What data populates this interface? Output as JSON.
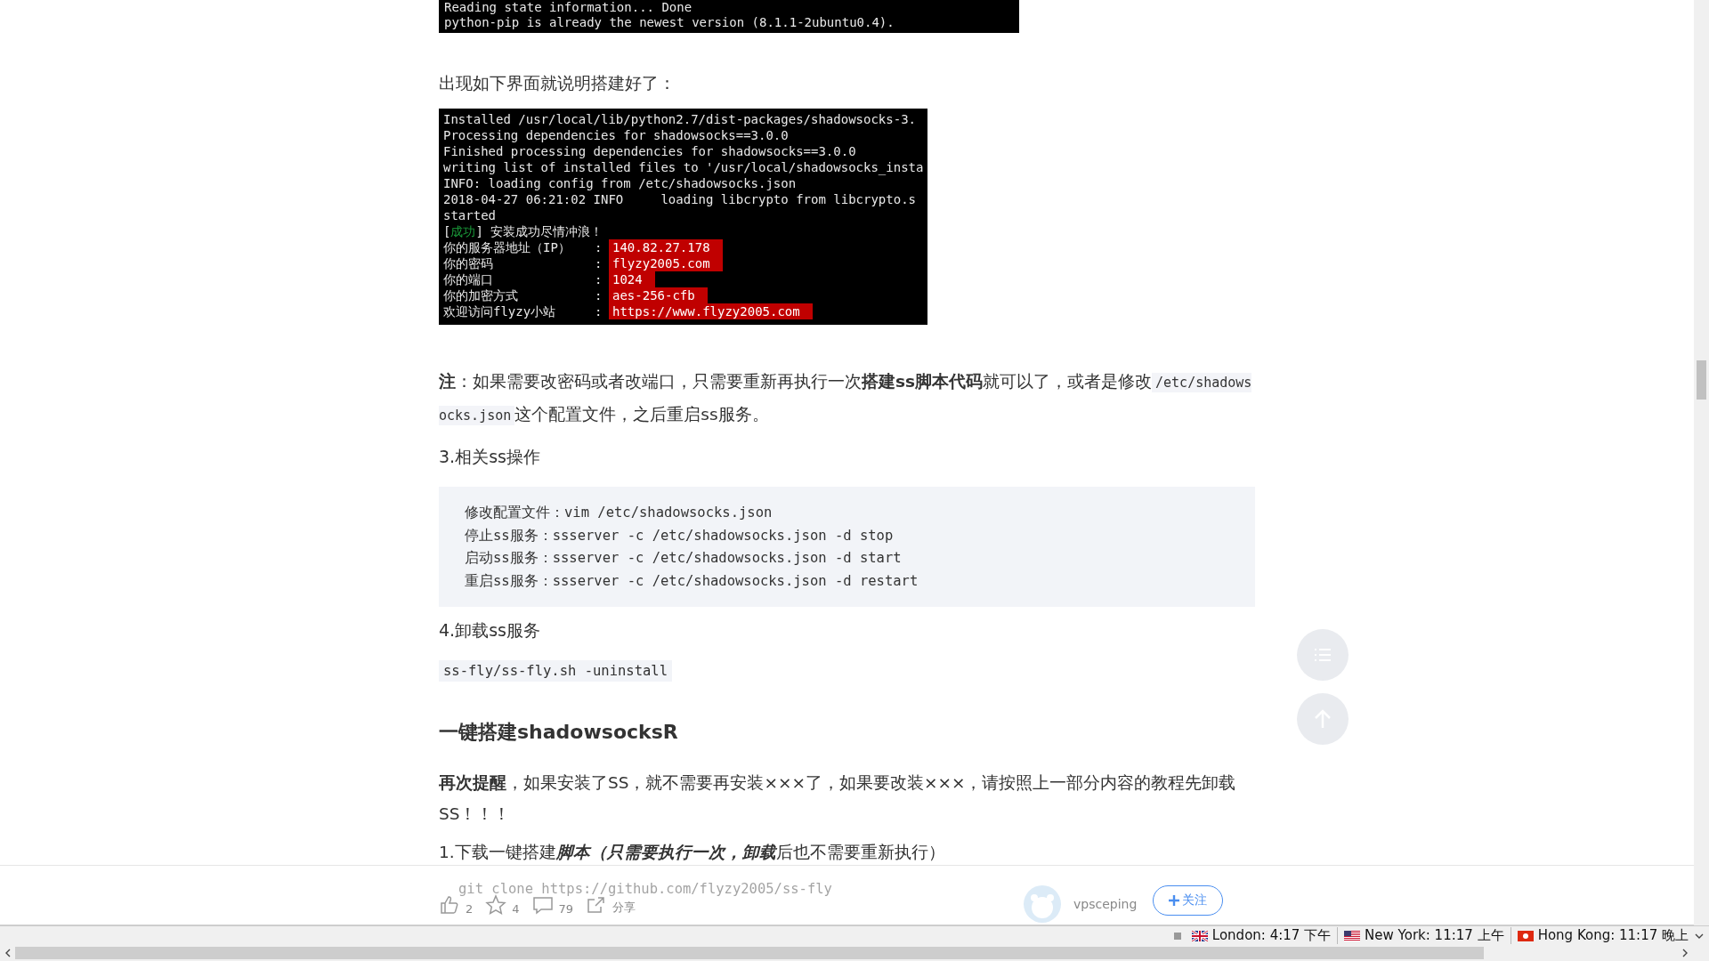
{
  "terminal_top": {
    "lines": [
      "Reading state information... Done",
      "python-pip is already the newest version (8.1.1-2ubuntu0.4)."
    ]
  },
  "caption": "出现如下界面就说明搭建好了：",
  "terminal": {
    "lines": [
      {
        "kind": "plain",
        "text": "Installed /usr/local/lib/python2.7/dist-packages/shadowsocks-3."
      },
      {
        "kind": "plain",
        "text": "Processing dependencies for shadowsocks==3.0.0"
      },
      {
        "kind": "plain",
        "text": "Finished processing dependencies for shadowsocks==3.0.0"
      },
      {
        "kind": "plain",
        "text": "writing list of installed files to '/usr/local/shadowsocks_insta"
      },
      {
        "kind": "plain",
        "text": "INFO: loading config from /etc/shadowsocks.json"
      },
      {
        "kind": "plain",
        "text": "2018-04-27 06:21:02 INFO     loading libcrypto from libcrypto.s"
      },
      {
        "kind": "plain",
        "text": "started"
      },
      {
        "kind": "status",
        "prefix": "[",
        "tag": "成功",
        "suffix": "] 安装成功尽情冲浪！"
      },
      {
        "kind": "info",
        "label": "你的服务器地址（IP）",
        "separator": ":",
        "value": "140.82.27.178"
      },
      {
        "kind": "info",
        "label": "你的密码",
        "separator": ":",
        "value": "flyzy2005.com"
      },
      {
        "kind": "info",
        "label": "你的端口",
        "separator": ":",
        "value": "1024"
      },
      {
        "kind": "info",
        "label": "你的加密方式",
        "separator": ":",
        "value": "aes-256-cfb"
      },
      {
        "kind": "info",
        "label": "欢迎访问flyzy小站",
        "separator": ":",
        "value": "https://www.flyzy2005.com"
      }
    ]
  },
  "note": [
    {
      "kind": "text",
      "text": "**注**：如果需要改密码或者改端口，只需要重新再执行一次**搭建ss脚本代码**就可以了，或者是修改"
    },
    {
      "kind": "code",
      "text": "/etc/shadowsocks.json"
    },
    {
      "kind": "text",
      "text": "这个配置文件，之后重启ss服务。"
    }
  ],
  "section_ops": {
    "heading": "3.相关ss操作",
    "code_lines": [
      "修改配置文件：vim /etc/shadowsocks.json",
      "停止ss服务：ssserver -c /etc/shadowsocks.json -d stop",
      "启动ss服务：ssserver -c /etc/shadowsocks.json -d start",
      "重启ss服务：ssserver -c /etc/shadowsocks.json -d restart"
    ]
  },
  "section_uninstall": {
    "heading": "4.卸载ss服务",
    "code": "ss-fly/ss-fly.sh -uninstall"
  },
  "ssr": {
    "heading": "一键搭建shadowsocksR",
    "reminder": "**再次提醒**，如果安装了SS，就不需要再安装×××了，如果要改装×××，请按照上一部分内容的教程先卸载SS！！！",
    "step": "1.下载一键搭建**脚本（只需要执行一次，卸载**后也不需要重新执行）",
    "code": "git clone https://github.com/flyzy2005/ss-fly"
  },
  "action_bar": {
    "actions": [
      {
        "kind": "like",
        "text": "2"
      },
      {
        "kind": "star",
        "text": "4"
      },
      {
        "kind": "comment",
        "text": "79"
      },
      {
        "kind": "share",
        "text": "分享"
      }
    ],
    "author": "vpsceping",
    "follow_button": "关注"
  },
  "clocks": [
    {
      "kind": "uk",
      "text": "London: 4:17 下午"
    },
    {
      "kind": "us",
      "text": "New York: 11:17 上午"
    },
    {
      "kind": "hk",
      "text": "Hong Kong: 11:17 晚上"
    }
  ]
}
